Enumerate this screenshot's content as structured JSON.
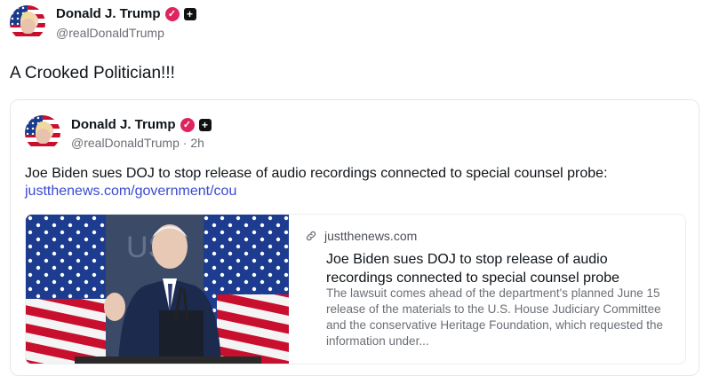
{
  "post": {
    "author_name": "Donald J. Trump",
    "author_handle": "@realDonaldTrump",
    "verified_icon": "✓",
    "plus_icon": "+",
    "text": "A Crooked Politician!!!"
  },
  "quoted_post": {
    "author_name": "Donald J. Trump",
    "author_handle": "@realDonaldTrump",
    "time_separator": "·",
    "time_ago": "2h",
    "verified_icon": "✓",
    "plus_icon": "+",
    "text": "Joe Biden sues DOJ to stop release of audio recordings connected to special counsel probe:",
    "link_text": "justthenews.com/government/cou",
    "link_card": {
      "domain": "justthenews.com",
      "title": "Joe Biden sues DOJ to stop release of audio recordings connected to special counsel probe",
      "description": "The lawsuit comes ahead of the department's planned June 15 release of the materials to the U.S. House Judiciary Committee and the conservative Heritage Foundation, which requested the information under..."
    }
  },
  "colors": {
    "verified": "#e0245e",
    "link": "#3a4bd0",
    "secondary_text": "#6b6f76"
  }
}
